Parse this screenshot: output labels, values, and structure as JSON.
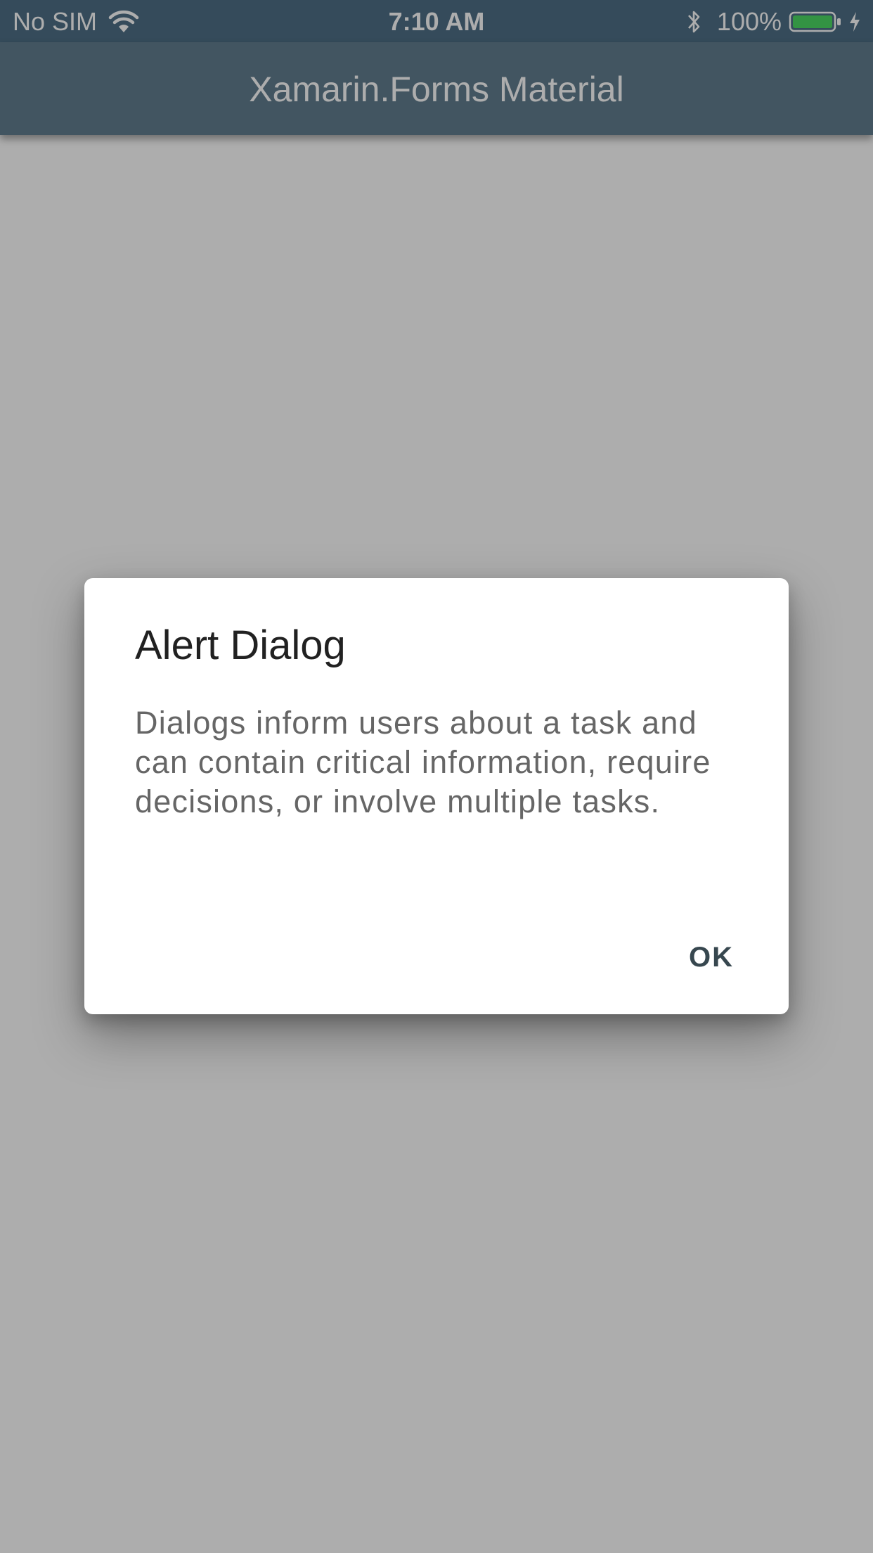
{
  "status_bar": {
    "carrier": "No SIM",
    "time": "7:10 AM",
    "battery_percent": "100%",
    "battery_level": 1.0,
    "battery_color": "#4cd964",
    "icons": [
      "wifi-icon",
      "bluetooth-icon",
      "battery-icon",
      "charging-icon"
    ]
  },
  "app_bar": {
    "title": "Xamarin.Forms Material",
    "color": "#627e90"
  },
  "dialog": {
    "title": "Alert Dialog",
    "message": "Dialogs inform users about a task and can contain critical information, require decisions, or involve multiple tasks.",
    "ok_label": "OK"
  }
}
